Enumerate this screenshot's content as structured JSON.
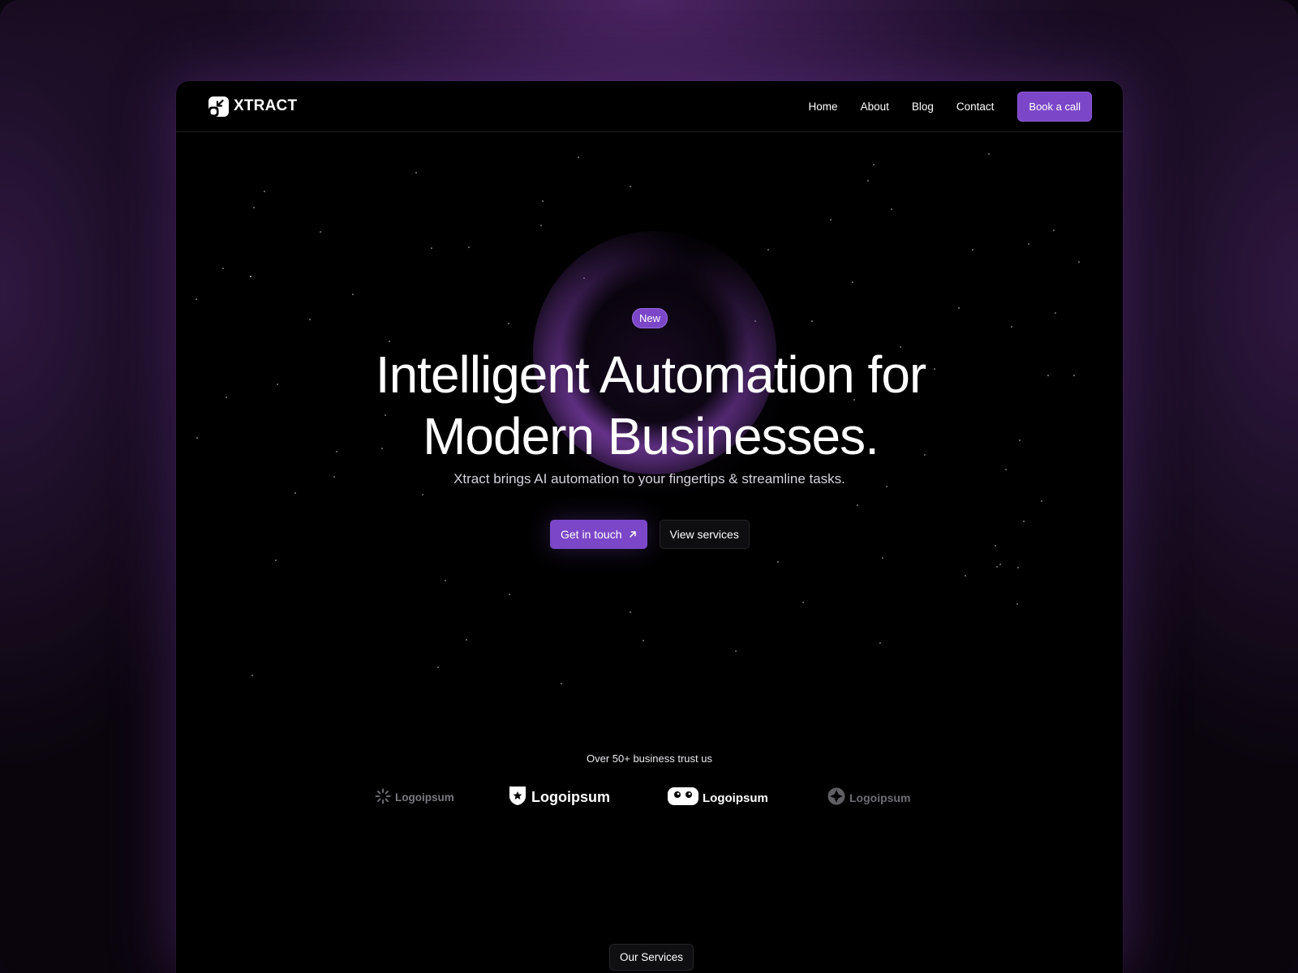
{
  "brand": {
    "name": "XTRACT",
    "icon": "xtract-logo-icon"
  },
  "nav": {
    "links": [
      "Home",
      "About",
      "Blog",
      "Contact"
    ],
    "cta": "Book a call"
  },
  "hero": {
    "badge": "New",
    "headline_line1": "Intelligent Automation for",
    "headline_line2": "Modern Businesses.",
    "subheadline": "Xtract brings AI automation to your fingertips & streamline tasks.",
    "primary_cta": "Get in touch",
    "primary_cta_icon": "arrow-up-right-icon",
    "secondary_cta": "View services"
  },
  "trust": {
    "heading": "Over 50+ business trust us",
    "logos": [
      {
        "name": "Logoipsum",
        "icon": "sunburst-logo-icon"
      },
      {
        "name": "Logoipsum",
        "icon": "shield-logo-icon"
      },
      {
        "name": "Logoipsum",
        "icon": "robot-logo-icon"
      },
      {
        "name": "Logoipsum",
        "icon": "diamond-logo-icon"
      }
    ]
  },
  "services_section": {
    "label": "Our Services"
  },
  "colors": {
    "accent": "#7b47c8",
    "background": "#000000",
    "frame_glow": "#5a2c82"
  }
}
